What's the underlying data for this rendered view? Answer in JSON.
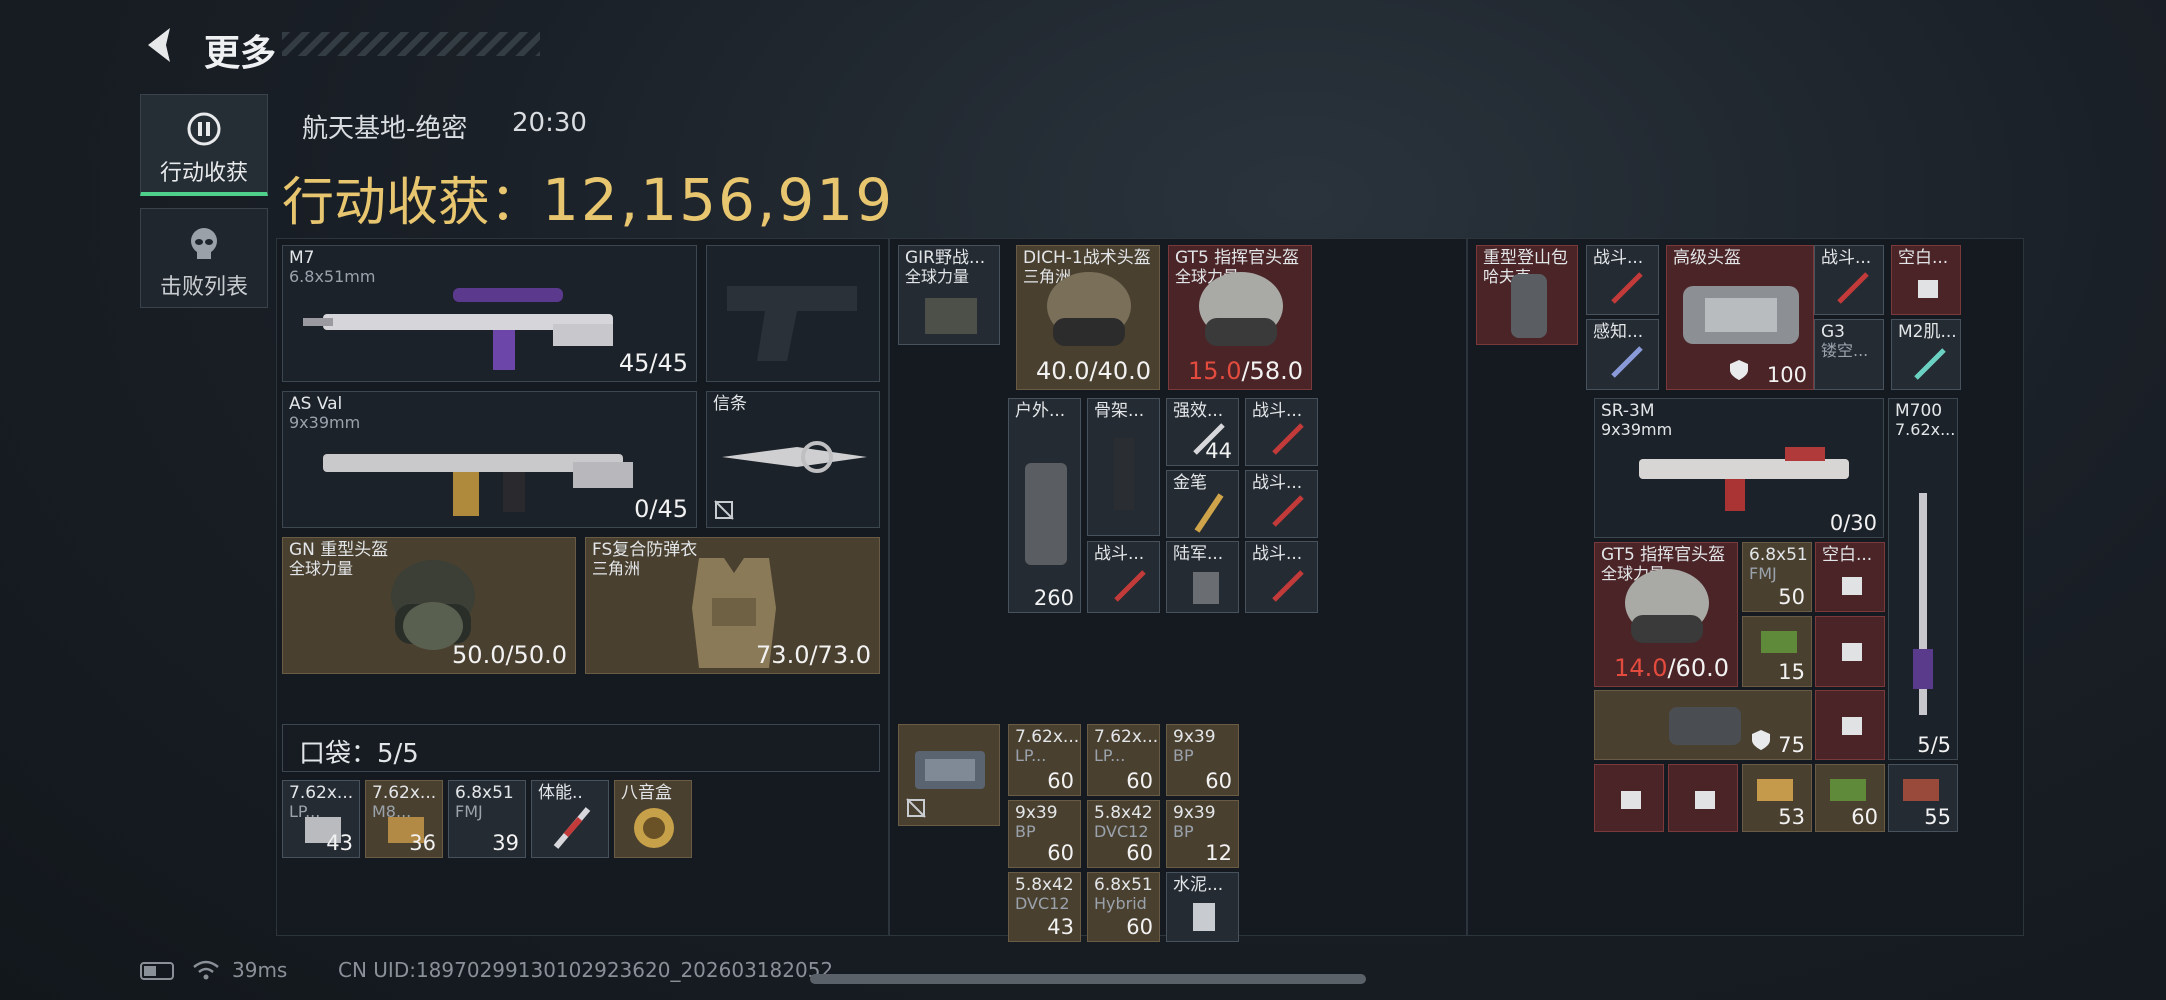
{
  "header": {
    "back_label": "更多"
  },
  "sidebar": {
    "tabs": [
      {
        "label": "行动收获"
      },
      {
        "label": "击败列表"
      }
    ]
  },
  "match": {
    "map": "航天基地-绝密",
    "time": "20:30"
  },
  "summary": {
    "label": "行动收获：",
    "value": "12,156,919"
  },
  "loadout": {
    "primary": {
      "name": "M7",
      "ammo": "6.8x51mm",
      "count": "45/45"
    },
    "secondary": {
      "name": "AS Val",
      "ammo": "9x39mm",
      "count": "0/45"
    },
    "melee": {
      "name": "信条"
    },
    "helmet": {
      "name": "GN 重型头盔",
      "source": "全球力量",
      "durability": "50.0/50.0"
    },
    "armor": {
      "name": "FS复合防弹衣",
      "source": "三角洲",
      "durability": "73.0/73.0"
    },
    "pocket": {
      "label": "口袋：5/5",
      "items": [
        {
          "name": "7.62x...",
          "sub": "LP...",
          "count": "43"
        },
        {
          "name": "7.62x...",
          "sub": "M8...",
          "count": "36"
        },
        {
          "name": "6.8x51",
          "sub": "FMJ",
          "count": "39"
        },
        {
          "name": "体能..",
          "sub": "",
          "count": ""
        },
        {
          "name": "八音盒",
          "sub": "",
          "count": ""
        }
      ]
    }
  },
  "middle": {
    "rig": {
      "name": "GIR野战...",
      "source": "全球力量"
    },
    "helmet1": {
      "name": "DICH-1战术头盔",
      "source": "三角洲",
      "durability_current": "40.0",
      "durability_max": "/40.0"
    },
    "helmet2": {
      "name": "GT5 指挥官头盔",
      "source": "全球力量",
      "durability_current": "15.0",
      "durability_max": "/58.0"
    },
    "grid": [
      {
        "name": "户外...",
        "count": "260"
      },
      {
        "name": "骨架...",
        "count": ""
      },
      {
        "name": "强效...",
        "count": "44"
      },
      {
        "name": "战斗...",
        "count": ""
      },
      {
        "name": "金笔",
        "count": ""
      },
      {
        "name": "战斗...",
        "count": ""
      },
      {
        "name": "战斗...",
        "count": ""
      },
      {
        "name": "陆军...",
        "count": ""
      },
      {
        "name": "战斗...",
        "count": ""
      }
    ],
    "ammo": [
      {
        "name": "7.62x...",
        "sub": "LP...",
        "count": "60"
      },
      {
        "name": "7.62x...",
        "sub": "LP...",
        "count": "60"
      },
      {
        "name": "9x39",
        "sub": "BP",
        "count": "60"
      },
      {
        "name": "9x39",
        "sub": "BP",
        "count": "60"
      },
      {
        "name": "5.8x42",
        "sub": "DVC12",
        "count": "60"
      },
      {
        "name": "9x39",
        "sub": "BP",
        "count": "12"
      },
      {
        "name": "5.8x42",
        "sub": "DVC12",
        "count": "43"
      },
      {
        "name": "6.8x51",
        "sub": "Hybrid",
        "count": "60"
      },
      {
        "name": "水泥...",
        "sub": "",
        "count": ""
      }
    ]
  },
  "right": {
    "backpack": {
      "name": "重型登山包",
      "sub": "哈夫克"
    },
    "top_items": [
      {
        "name": "战斗..."
      },
      {
        "name": "感知..."
      },
      {
        "name": "战斗..."
      },
      {
        "name": "G3",
        "sub": "镂空..."
      },
      {
        "name": "空白..."
      },
      {
        "name": "M2肌..."
      }
    ],
    "case": {
      "name": "高级头盔",
      "count": "100"
    },
    "sr3m": {
      "name": "SR-3M",
      "ammo": "9x39mm",
      "count": "0/30"
    },
    "m700": {
      "name": "M700",
      "ammo": "7.62x...",
      "count": "5/5"
    },
    "helmet": {
      "name": "GT5 指挥官头盔",
      "source": "全球力量",
      "durability_current": "14.0",
      "durability_max": "/60.0"
    },
    "ammo": [
      {
        "name": "6.8x51",
        "sub": "FMJ",
        "count": "50"
      },
      {
        "name": "",
        "sub": "",
        "count": "15"
      },
      {
        "name": "空白...",
        "sub": "",
        "count": ""
      }
    ],
    "bag": {
      "count": "75"
    },
    "bottom": [
      {
        "count": ""
      },
      {
        "count": ""
      },
      {
        "count": "53"
      },
      {
        "count": "60"
      },
      {
        "count": "55"
      }
    ]
  },
  "status": {
    "ping": "39ms",
    "uid": "CN UID:18970299130102923620_202603182052"
  }
}
